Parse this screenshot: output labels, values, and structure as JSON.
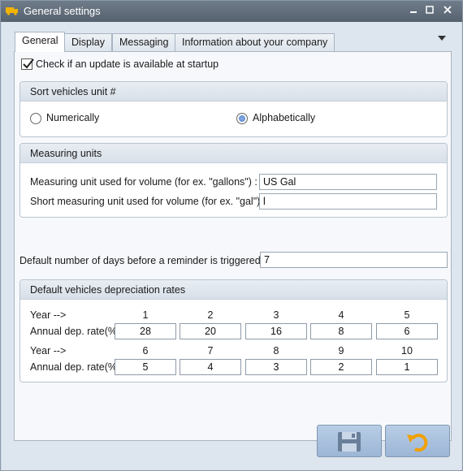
{
  "window": {
    "title": "General settings",
    "minimize_icon": "minimize-icon",
    "maximize_icon": "maximize-icon",
    "close_icon": "close-icon"
  },
  "tabs": [
    {
      "label": "General",
      "active": true
    },
    {
      "label": "Display",
      "active": false
    },
    {
      "label": "Messaging",
      "active": false
    },
    {
      "label": "Information about your company",
      "active": false
    }
  ],
  "general": {
    "update_check": {
      "label": "Check if an update is available at startup",
      "checked": true
    },
    "sort_group": {
      "title": "Sort vehicles unit #",
      "options": [
        {
          "label": "Numerically",
          "selected": false
        },
        {
          "label": "Alphabetically",
          "selected": true
        }
      ]
    },
    "measuring_group": {
      "title": "Measuring units",
      "volume_label": "Measuring unit used for volume (for ex. \"gallons\") :",
      "volume_value": "US Gal",
      "short_label": "Short measuring unit used for volume (for ex. \"gal\") :",
      "short_value": "l"
    },
    "reminder": {
      "label": "Default number of days before a reminder is triggered :",
      "value": "7"
    },
    "depreciation_group": {
      "title": "Default vehicles depreciation rates",
      "year_label": "Year -->",
      "rate_label": "Annual dep. rate(%",
      "row1": {
        "years": [
          "1",
          "2",
          "3",
          "4",
          "5"
        ],
        "rates": [
          "28",
          "20",
          "16",
          "8",
          "6"
        ]
      },
      "row2": {
        "years": [
          "6",
          "7",
          "8",
          "9",
          "10"
        ],
        "rates": [
          "5",
          "4",
          "3",
          "2",
          "1"
        ]
      }
    }
  },
  "buttons": {
    "save_icon": "save-icon",
    "undo_icon": "undo-icon"
  },
  "colors": {
    "titlebar": "#5f6b78",
    "client_bg": "#dde5ee",
    "button_bg": "#a9c1de",
    "undo_accent": "#f0a000"
  }
}
